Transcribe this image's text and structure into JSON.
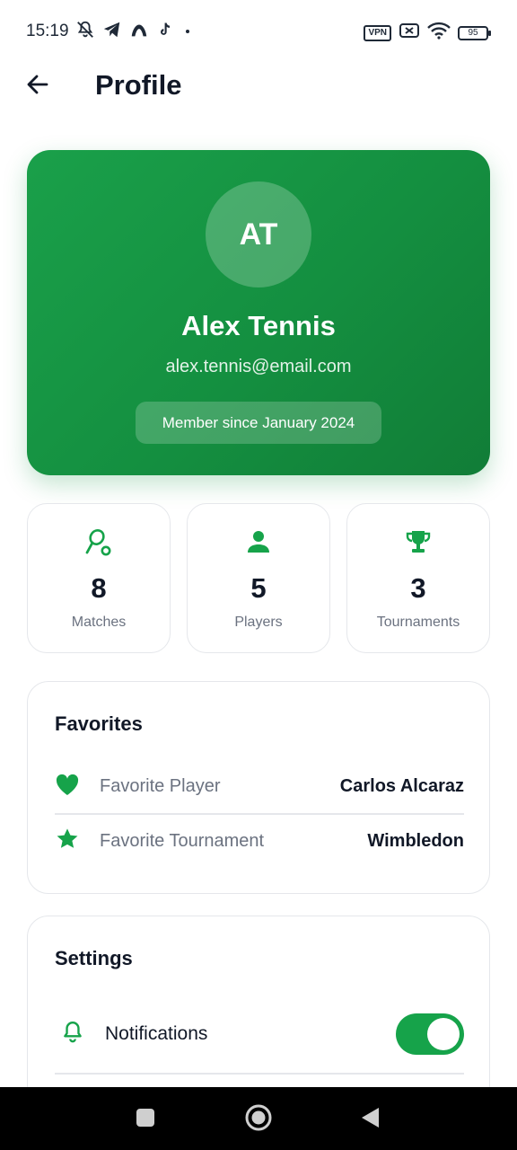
{
  "status_bar": {
    "time": "15:19",
    "vpn_label": "VPN",
    "battery_level": "95",
    "left_icons": [
      "mute-icon",
      "telegram-icon",
      "app-icon",
      "tiktok-icon",
      "dot-icon"
    ],
    "right_icons": [
      "vpn-icon",
      "sim-icon",
      "wifi-icon",
      "battery-icon"
    ]
  },
  "header": {
    "title": "Profile",
    "back_icon": "arrow-left-icon"
  },
  "profile": {
    "initials": "AT",
    "name": "Alex Tennis",
    "email": "alex.tennis@email.com",
    "member_since": "Member since January 2024",
    "accent_color": "#16a34a"
  },
  "stats": [
    {
      "icon": "racket-icon",
      "value": "8",
      "label": "Matches"
    },
    {
      "icon": "person-icon",
      "value": "5",
      "label": "Players"
    },
    {
      "icon": "trophy-icon",
      "value": "3",
      "label": "Tournaments"
    }
  ],
  "favorites": {
    "title": "Favorites",
    "items": [
      {
        "icon": "heart-icon",
        "label": "Favorite Player",
        "value": "Carlos Alcaraz"
      },
      {
        "icon": "star-icon",
        "label": "Favorite Tournament",
        "value": "Wimbledon"
      }
    ]
  },
  "settings": {
    "title": "Settings",
    "items": [
      {
        "icon": "bell-icon",
        "label": "Notifications",
        "enabled": true
      }
    ]
  },
  "nav_bar": {
    "buttons": [
      "recents-icon",
      "home-icon",
      "back-triangle-icon"
    ]
  }
}
